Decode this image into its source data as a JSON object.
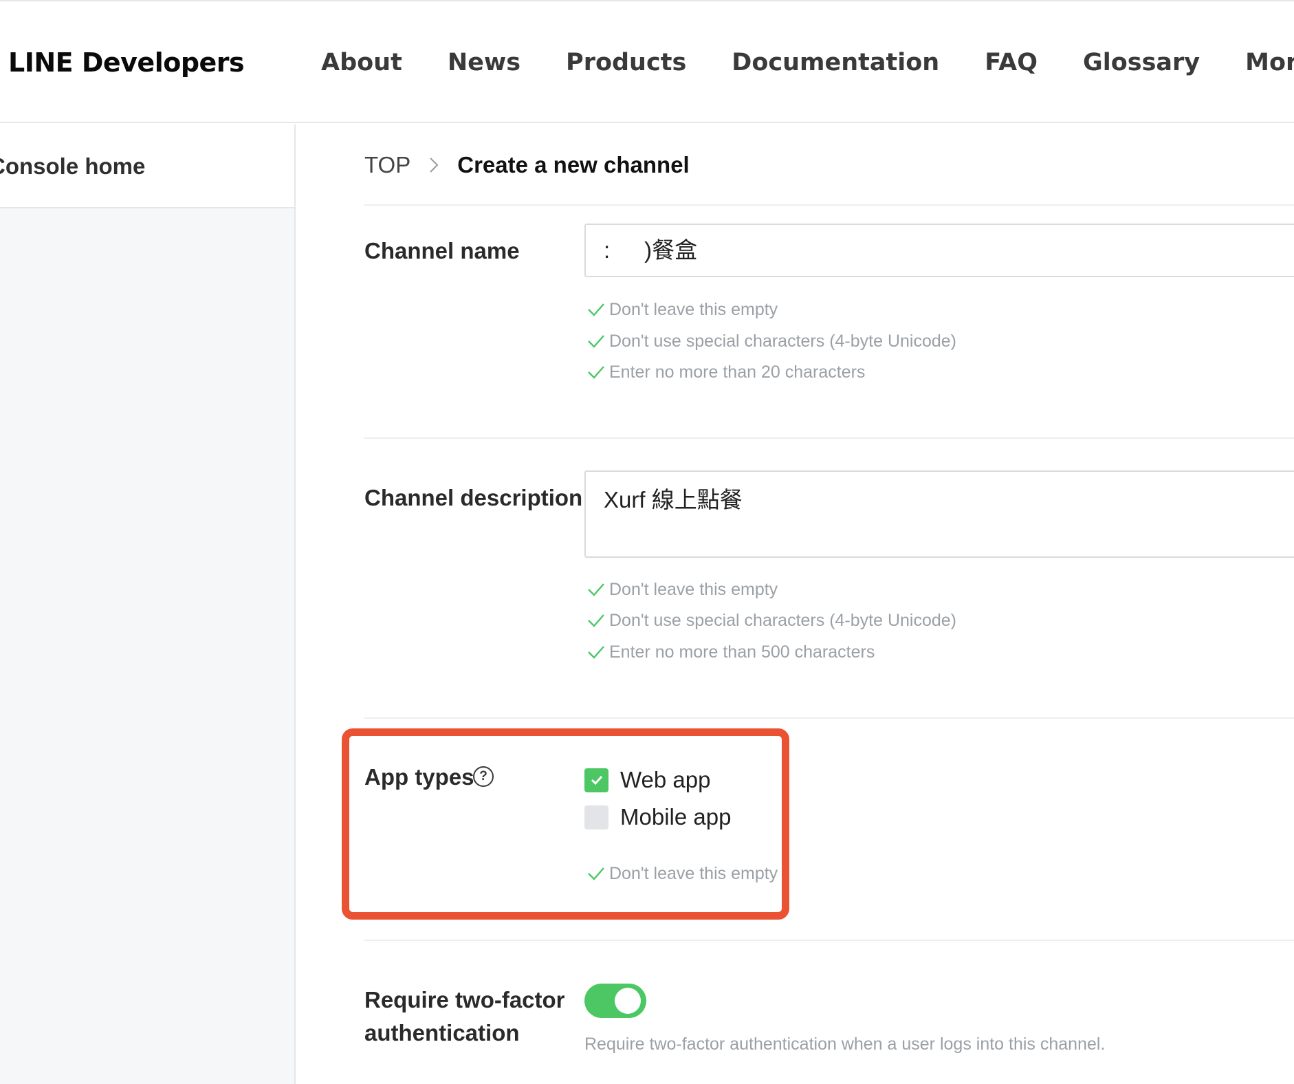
{
  "header": {
    "logo": "LINE Developers",
    "nav": [
      "About",
      "News",
      "Products",
      "Documentation",
      "FAQ",
      "Glossary",
      "More"
    ]
  },
  "sidebar": {
    "home_label": "Console home"
  },
  "breadcrumb": {
    "top": "TOP",
    "separator": ">",
    "current": "Create a new channel"
  },
  "form": {
    "channel_name": {
      "label": "Channel name",
      "value_prefix": ":",
      "value_suffix": ")餐盒",
      "rules": [
        "Don't leave this empty",
        "Don't use special characters (4-byte Unicode)",
        "Enter no more than 20 characters"
      ]
    },
    "channel_description": {
      "label": "Channel description",
      "value": "Xurf 線上點餐",
      "rules": [
        "Don't leave this empty",
        "Don't use special characters (4-byte Unicode)",
        "Enter no more than 500 characters"
      ]
    },
    "app_types": {
      "label": "App types",
      "help_icon": "?",
      "options": [
        {
          "label": "Web app",
          "checked": true
        },
        {
          "label": "Mobile app",
          "checked": false
        }
      ],
      "rules": [
        "Don't leave this empty"
      ]
    },
    "two_factor": {
      "label_line1": "Require two-factor",
      "label_line2": "authentication",
      "enabled": true,
      "description": "Require two-factor authentication when a user logs into this channel."
    }
  },
  "colors": {
    "accent_green": "#4cc764",
    "highlight_red": "#ea5233",
    "muted_text": "#9aa0a6"
  }
}
